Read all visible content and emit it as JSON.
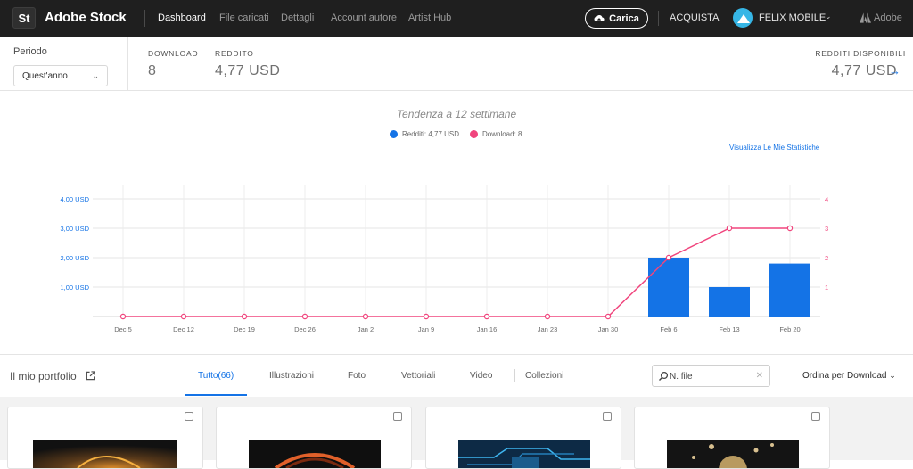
{
  "header": {
    "logo": "St",
    "brand": "Adobe Stock",
    "nav": [
      "Dashboard",
      "File caricati",
      "Dettagli",
      "Account autore",
      "Artist Hub"
    ],
    "upload_label": "Carica",
    "buy_label": "ACQUISTA",
    "user_name": "FELIX MOBILE",
    "adobe_label": "Adobe"
  },
  "summary": {
    "period_label": "Periodo",
    "period_value": "Quest'anno",
    "downloads_label": "DOWNLOAD",
    "downloads_value": "8",
    "revenue_label": "REDDITO",
    "revenue_value": "4,77 USD",
    "available_label": "REDDITI DISPONIBILI",
    "available_value": "4,77 USD"
  },
  "chart": {
    "title": "Tendenza a 12 settimane",
    "legend_revenue": "Redditi: 4,77 USD",
    "legend_downloads": "Download: 8",
    "stats_link": "Visualizza Le Mie Statistiche"
  },
  "chart_data": {
    "type": "bar",
    "title": "Tendenza a 12 settimane",
    "categories": [
      "Dec 5",
      "Dec 12",
      "Dec 19",
      "Dec 26",
      "Jan 2",
      "Jan 9",
      "Jan 16",
      "Jan 23",
      "Jan 30",
      "Feb 6",
      "Feb 13",
      "Feb 20"
    ],
    "series": [
      {
        "name": "Redditi: 4,77 USD",
        "type": "bar",
        "axis": "left",
        "color": "#1473e6",
        "values": [
          0,
          0,
          0,
          0,
          0,
          0,
          0,
          0,
          0,
          2.0,
          1.0,
          1.8
        ]
      },
      {
        "name": "Download: 8",
        "type": "line",
        "axis": "right",
        "color": "#f0457d",
        "values": [
          0,
          0,
          0,
          0,
          0,
          0,
          0,
          0,
          0,
          2,
          3,
          3
        ]
      }
    ],
    "left_axis": {
      "ticks": [
        "4,00 USD",
        "3,00 USD",
        "2,00 USD",
        "1,00 USD"
      ],
      "ylim": [
        0,
        4.5
      ]
    },
    "right_axis": {
      "ticks": [
        "4",
        "3",
        "2",
        "1"
      ],
      "ylim": [
        0,
        4.5
      ]
    },
    "grid": true
  },
  "portfolio": {
    "title": "Il mio portfolio",
    "tabs": [
      "Tutto(66)",
      "Illustrazioni",
      "Foto",
      "Vettoriali",
      "Video",
      "Collezioni"
    ],
    "search_placeholder": "N. file",
    "sort_label": "Ordina per Download"
  },
  "colors": {
    "accent": "#1473e6",
    "downloads_line": "#f0457d",
    "topbar": "#1f1f1f"
  }
}
